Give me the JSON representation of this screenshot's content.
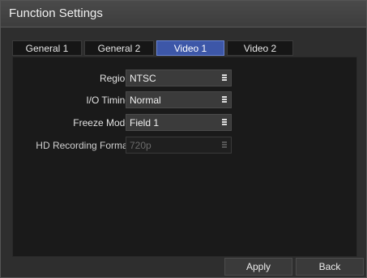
{
  "window": {
    "title": "Function Settings"
  },
  "tabs": [
    {
      "label": "General 1",
      "active": false
    },
    {
      "label": "General 2",
      "active": false
    },
    {
      "label": "Video 1",
      "active": true
    },
    {
      "label": "Video 2",
      "active": false
    }
  ],
  "settings": [
    {
      "label": "Region",
      "value": "NTSC",
      "enabled": true,
      "icon": "list-handle-icon"
    },
    {
      "label": "I/O Timing",
      "value": "Normal",
      "enabled": true,
      "icon": "list-handle-icon"
    },
    {
      "label": "Freeze Mode",
      "value": "Field 1",
      "enabled": true,
      "icon": "list-handle-icon"
    },
    {
      "label": "HD Recording Format",
      "value": "720p",
      "enabled": false,
      "icon": "list-handle-icon"
    }
  ],
  "footer": {
    "apply_label": "Apply",
    "back_label": "Back"
  },
  "colors": {
    "accent": "#3d57a8",
    "background": "#2e2e2e",
    "panel": "#1a1a1a"
  }
}
